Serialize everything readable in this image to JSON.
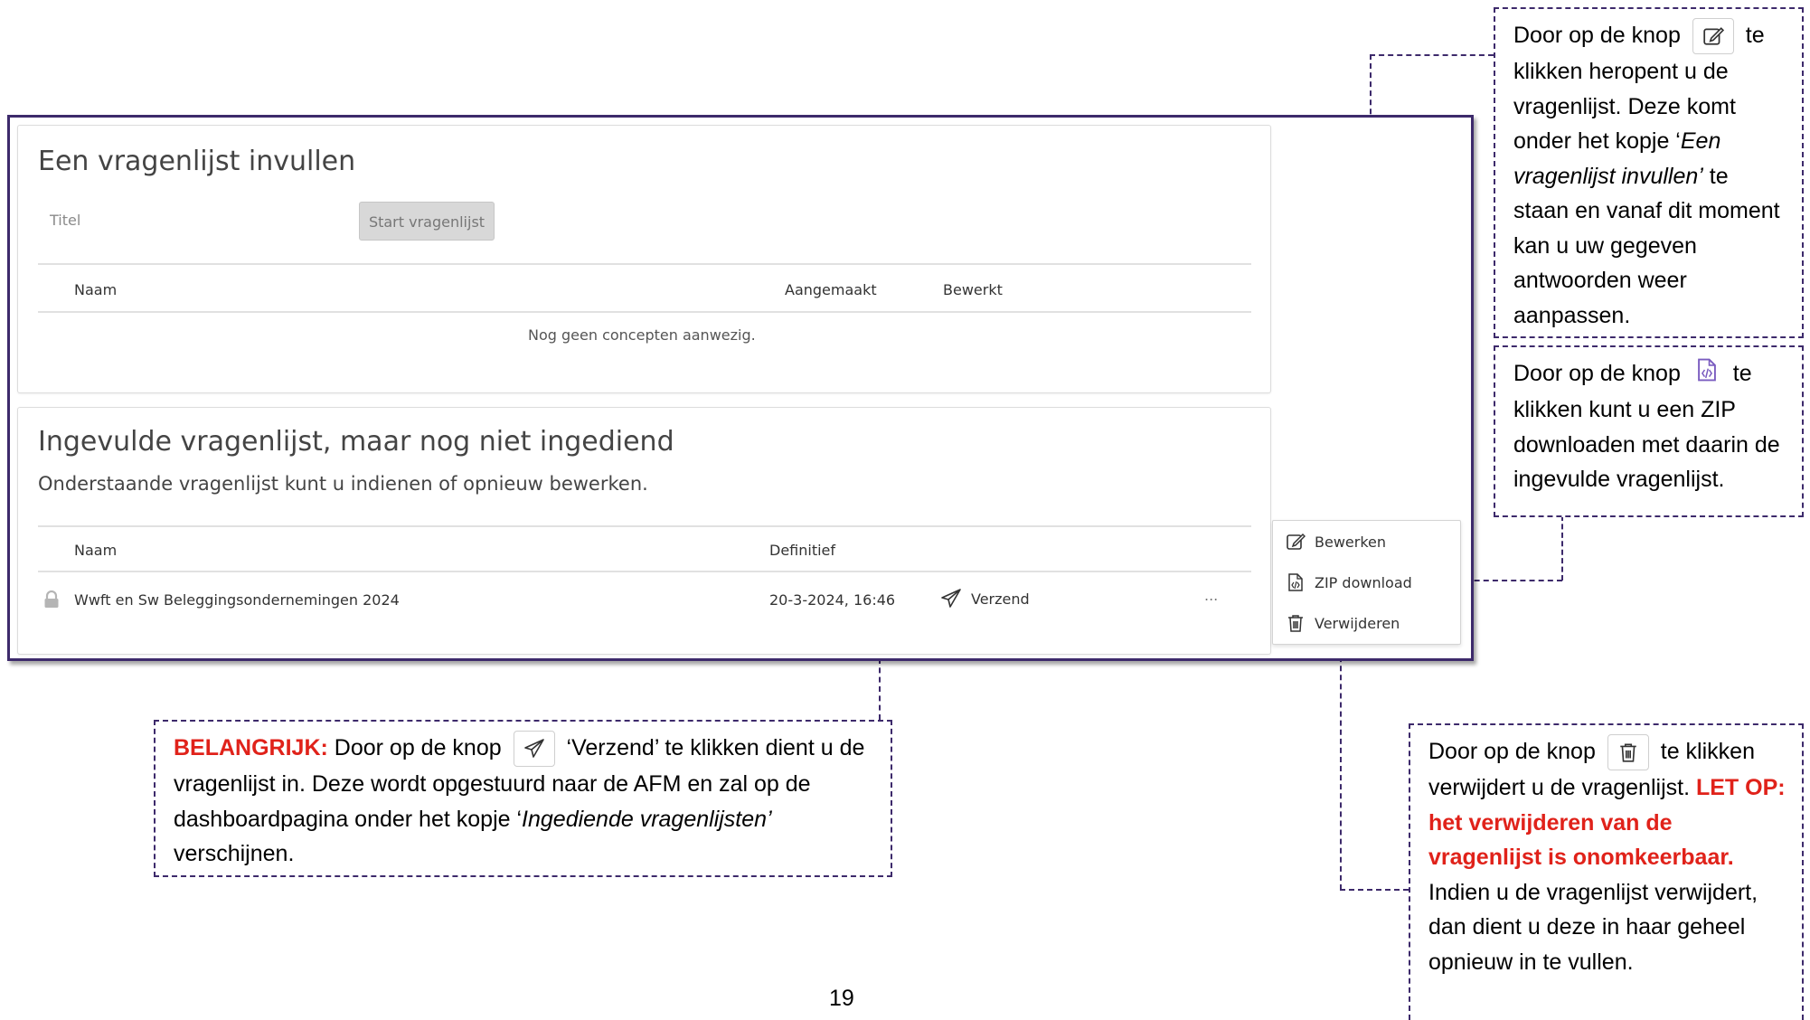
{
  "card_draft": {
    "title": "Een vragenlijst invullen",
    "title_field_placeholder": "Titel",
    "start_button": "Start vragenlijst",
    "columns": [
      "Naam",
      "Aangemaakt",
      "Bewerkt"
    ],
    "empty_message": "Nog geen concepten aanwezig."
  },
  "card_pending": {
    "title": "Ingevulde vragenlijst, maar nog niet ingediend",
    "subtitle": "Onderstaande vragenlijst kunt u indienen of opnieuw bewerken.",
    "columns": [
      "Naam",
      "Definitief"
    ],
    "row": {
      "name": "Wwft en Sw Beleggingsondernemingen 2024",
      "date": "20-3-2024, 16:46",
      "send_label": "Verzend",
      "more_label": "..."
    }
  },
  "context_menu": {
    "items": [
      {
        "label": "Bewerken",
        "icon": "edit-icon"
      },
      {
        "label": "ZIP download",
        "icon": "file-code-icon"
      },
      {
        "label": "Verwijderen",
        "icon": "trash-icon"
      }
    ]
  },
  "callouts": {
    "edit": {
      "pre": "Door op de knop",
      "post": "te klikken heropent u de vragenlijst. Deze komt onder het kopje ‘",
      "italic": "Een vragenlijst invullen’",
      "end": " te staan en vanaf dit moment kan u uw gegeven antwoorden weer aanpassen."
    },
    "zip": {
      "pre": "Door op de knop",
      "post": "te klikken kunt u een ZIP downloaden met daarin de ingevulde vragenlijst."
    },
    "send": {
      "important": "BELANGRIJK:",
      "pre": " Door op de knop",
      "post": "‘Verzend’ te klikken dient u de vragenlijst in. Deze wordt opgestuurd naar de AFM en zal op de dashboardpagina onder het kopje ‘",
      "italic": "Ingediende vragenlijsten’",
      "end": " verschijnen."
    },
    "delete": {
      "pre": "Door op de knop",
      "post": "te klikken verwijdert u de vragenlijst. ",
      "warning": "LET OP: het verwijderen van de vragenlijst is onomkeerbaar.",
      "end": " Indien u de vragenlijst verwijdert, dan dient u deze in haar geheel opnieuw in te vullen."
    }
  },
  "page_number": "19",
  "colors": {
    "frame": "#3d2a6b",
    "important": "#e0221a"
  }
}
